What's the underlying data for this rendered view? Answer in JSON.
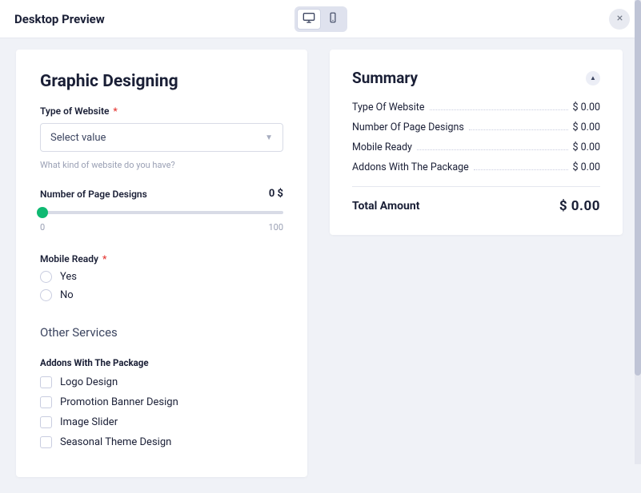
{
  "header": {
    "title": "Desktop Preview"
  },
  "form": {
    "title": "Graphic Designing",
    "type_of_website": {
      "label": "Type of Website",
      "placeholder": "Select value",
      "helper": "What kind of website do you have?"
    },
    "page_designs": {
      "label": "Number of Page Designs",
      "value": "0 $",
      "min": "0",
      "max": "100"
    },
    "mobile_ready": {
      "label": "Mobile Ready",
      "options": {
        "yes": "Yes",
        "no": "No"
      }
    },
    "other_services_heading": "Other Services",
    "addons": {
      "label": "Addons With The Package",
      "items": [
        "Logo Design",
        "Promotion Banner Design",
        "Image Slider",
        "Seasonal Theme Design"
      ]
    }
  },
  "summary": {
    "title": "Summary",
    "rows": [
      {
        "label": "Type Of Website",
        "value": "$ 0.00"
      },
      {
        "label": "Number Of Page Designs",
        "value": "$ 0.00"
      },
      {
        "label": "Mobile Ready",
        "value": "$ 0.00"
      },
      {
        "label": "Addons With The Package",
        "value": "$ 0.00"
      }
    ],
    "total_label": "Total Amount",
    "total_value": "$ 0.00"
  }
}
